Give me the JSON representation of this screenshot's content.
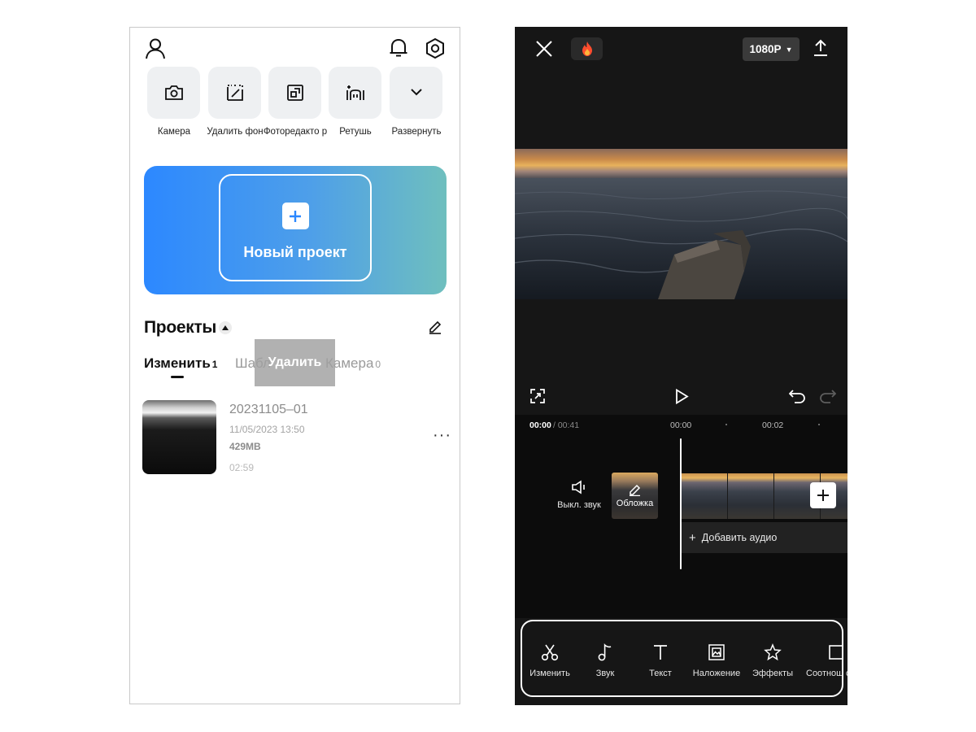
{
  "home": {
    "quick_actions": [
      {
        "label": "Камера",
        "icon": "camera-icon"
      },
      {
        "label": "Удалить фон",
        "icon": "remove-background-icon"
      },
      {
        "label": "Фоторедакто р",
        "icon": "photo-editor-icon"
      },
      {
        "label": "Ретушь",
        "icon": "retouch-icon"
      },
      {
        "label": "Развернуть",
        "icon": "chevron-down-icon"
      }
    ],
    "new_project_label": "Новый проект",
    "projects_title": "Проекты",
    "tabs": [
      {
        "label": "Изменить",
        "count": "1"
      },
      {
        "label": "Шабл",
        "count": ""
      },
      {
        "label": "Камера",
        "count": "0"
      }
    ],
    "delete_label": "Удалить",
    "project": {
      "name": "20231105–01",
      "date": "11/05/2023 13:50",
      "size": "429MB",
      "duration": "02:59"
    },
    "more_label": "···"
  },
  "editor": {
    "resolution": "1080P",
    "current_time": "00:00",
    "total_time": "/ 00:41",
    "ticks": [
      "00:00",
      "00:02"
    ],
    "mute_label": "Выкл. звук",
    "cover_label": "Обложка",
    "add_audio_label": "Добавить аудио",
    "tools": [
      {
        "label": "Изменить",
        "icon": "scissors-icon"
      },
      {
        "label": "Звук",
        "icon": "music-note-icon"
      },
      {
        "label": "Текст",
        "icon": "text-icon"
      },
      {
        "label": "Наложение",
        "icon": "overlay-icon"
      },
      {
        "label": "Эффекты",
        "icon": "effects-icon"
      },
      {
        "label": "Соотнош сторо",
        "icon": "aspect-ratio-icon"
      }
    ]
  }
}
